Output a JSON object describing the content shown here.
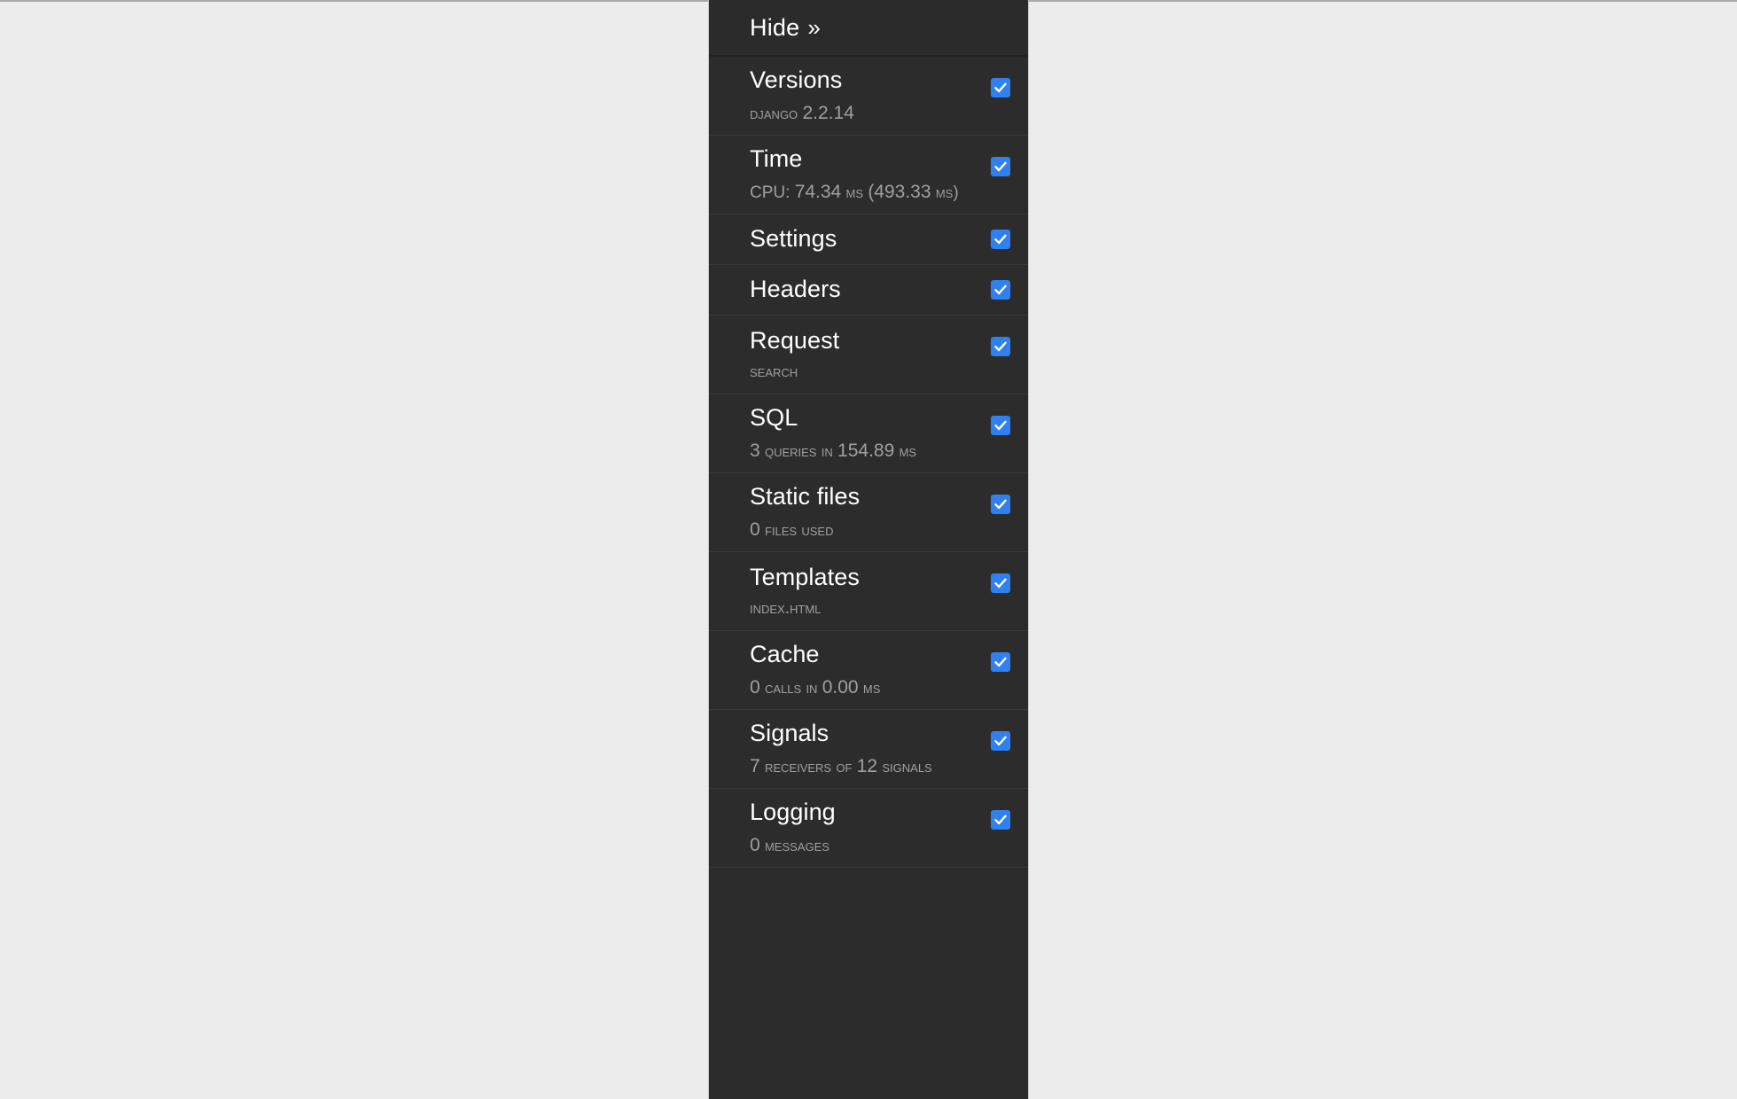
{
  "page": {
    "background_color": "#ececec",
    "toolbar_background": "#2c2c2c",
    "accent_color": "#2f80f0",
    "title_color": "#ffffff",
    "subtitle_color": "#a0a0a0"
  },
  "toolbar": {
    "hide_label": "Hide",
    "hide_chevron": "»",
    "checkbox_icon": "checkmark-icon",
    "panels": [
      {
        "id": "versions",
        "title": "Versions",
        "subtitle_parts": [
          {
            "text": "Django",
            "style": "smallcaps"
          },
          {
            "text": "2.2.14",
            "style": "number"
          }
        ],
        "enabled": true
      },
      {
        "id": "time",
        "title": "Time",
        "subtitle_parts": [
          {
            "text": "CPU:",
            "style": "plain"
          },
          {
            "text": "74.34",
            "style": "number"
          },
          {
            "text": "ms",
            "style": "smallcaps"
          },
          {
            "text": "(493.33",
            "style": "number"
          },
          {
            "text": "ms)",
            "style": "smallcaps"
          }
        ],
        "enabled": true
      },
      {
        "id": "settings",
        "title": "Settings",
        "subtitle_parts": [],
        "enabled": true
      },
      {
        "id": "headers",
        "title": "Headers",
        "subtitle_parts": [],
        "enabled": true
      },
      {
        "id": "request",
        "title": "Request",
        "subtitle_parts": [
          {
            "text": "search",
            "style": "smallcaps"
          }
        ],
        "enabled": true
      },
      {
        "id": "sql",
        "title": "SQL",
        "subtitle_parts": [
          {
            "text": "3",
            "style": "number"
          },
          {
            "text": "queries in",
            "style": "smallcaps"
          },
          {
            "text": "154.89",
            "style": "number"
          },
          {
            "text": "ms",
            "style": "smallcaps"
          }
        ],
        "enabled": true
      },
      {
        "id": "staticfiles",
        "title": "Static files",
        "subtitle_parts": [
          {
            "text": "0",
            "style": "number"
          },
          {
            "text": "files used",
            "style": "smallcaps"
          }
        ],
        "enabled": true
      },
      {
        "id": "templates",
        "title": "Templates",
        "subtitle_parts": [
          {
            "text": "index.html",
            "style": "smallcaps"
          }
        ],
        "enabled": true
      },
      {
        "id": "cache",
        "title": "Cache",
        "subtitle_parts": [
          {
            "text": "0",
            "style": "number"
          },
          {
            "text": "calls in",
            "style": "smallcaps"
          },
          {
            "text": "0.00",
            "style": "number"
          },
          {
            "text": "ms",
            "style": "smallcaps"
          }
        ],
        "enabled": true
      },
      {
        "id": "signals",
        "title": "Signals",
        "subtitle_parts": [
          {
            "text": "7",
            "style": "number"
          },
          {
            "text": "receivers of",
            "style": "smallcaps"
          },
          {
            "text": "12",
            "style": "number"
          },
          {
            "text": "signals",
            "style": "smallcaps"
          }
        ],
        "enabled": true
      },
      {
        "id": "logging",
        "title": "Logging",
        "subtitle_parts": [
          {
            "text": "0",
            "style": "number"
          },
          {
            "text": "messages",
            "style": "smallcaps"
          }
        ],
        "enabled": true
      }
    ]
  }
}
